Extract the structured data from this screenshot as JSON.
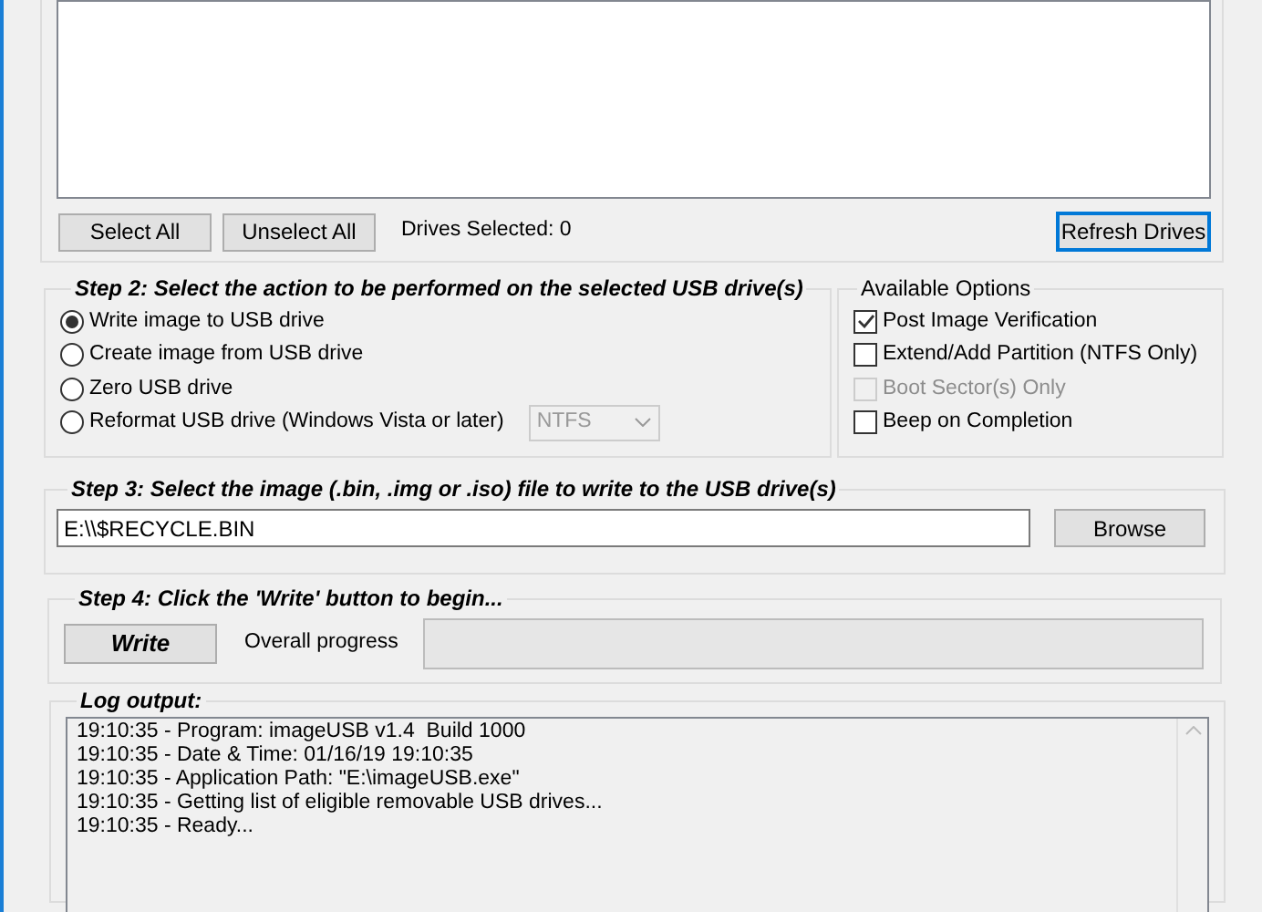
{
  "step1": {
    "buttons": [
      "Select All",
      "Unselect All"
    ],
    "drives_selected": "Drives Selected: 0",
    "refresh": "Refresh Drives"
  },
  "step2": {
    "title": "Step 2: Select the action to be performed on the selected USB drive(s)",
    "actions": [
      {
        "label": "Write image to USB drive",
        "selected": true
      },
      {
        "label": "Create image from USB drive",
        "selected": false
      },
      {
        "label": "Zero USB drive",
        "selected": false
      },
      {
        "label": "Reformat USB drive (Windows Vista or later)",
        "selected": false
      }
    ],
    "format": {
      "value": "NTFS",
      "disabled": true
    }
  },
  "options": {
    "title": "Available Options",
    "items": [
      {
        "label": "Post Image Verification",
        "checked": true,
        "disabled": false
      },
      {
        "label": "Extend/Add Partition (NTFS Only)",
        "checked": false,
        "disabled": false
      },
      {
        "label": "Boot Sector(s) Only",
        "checked": false,
        "disabled": true
      },
      {
        "label": "Beep on Completion",
        "checked": false,
        "disabled": false
      }
    ]
  },
  "step3": {
    "title": "Step 3: Select the image (.bin, .img or .iso) file to write to the USB drive(s)",
    "path": "E:\\\\$RECYCLE.BIN",
    "browse": "Browse"
  },
  "step4": {
    "title": "Step 4: Click the 'Write' button to begin...",
    "write": "Write",
    "progress_label": "Overall progress",
    "level": 0
  },
  "log": {
    "title": "Log output:",
    "lines": [
      "19:10:35 - Program: imageUSB v1.4  Build 1000",
      "19:10:35 - Date & Time: 01/16/19 19:10:35",
      "19:10:35 - Application Path: \"E:\\imageUSB.exe\"",
      "19:10:35 - Getting list of eligible removable USB drives...",
      "19:10:35 - Ready..."
    ]
  }
}
